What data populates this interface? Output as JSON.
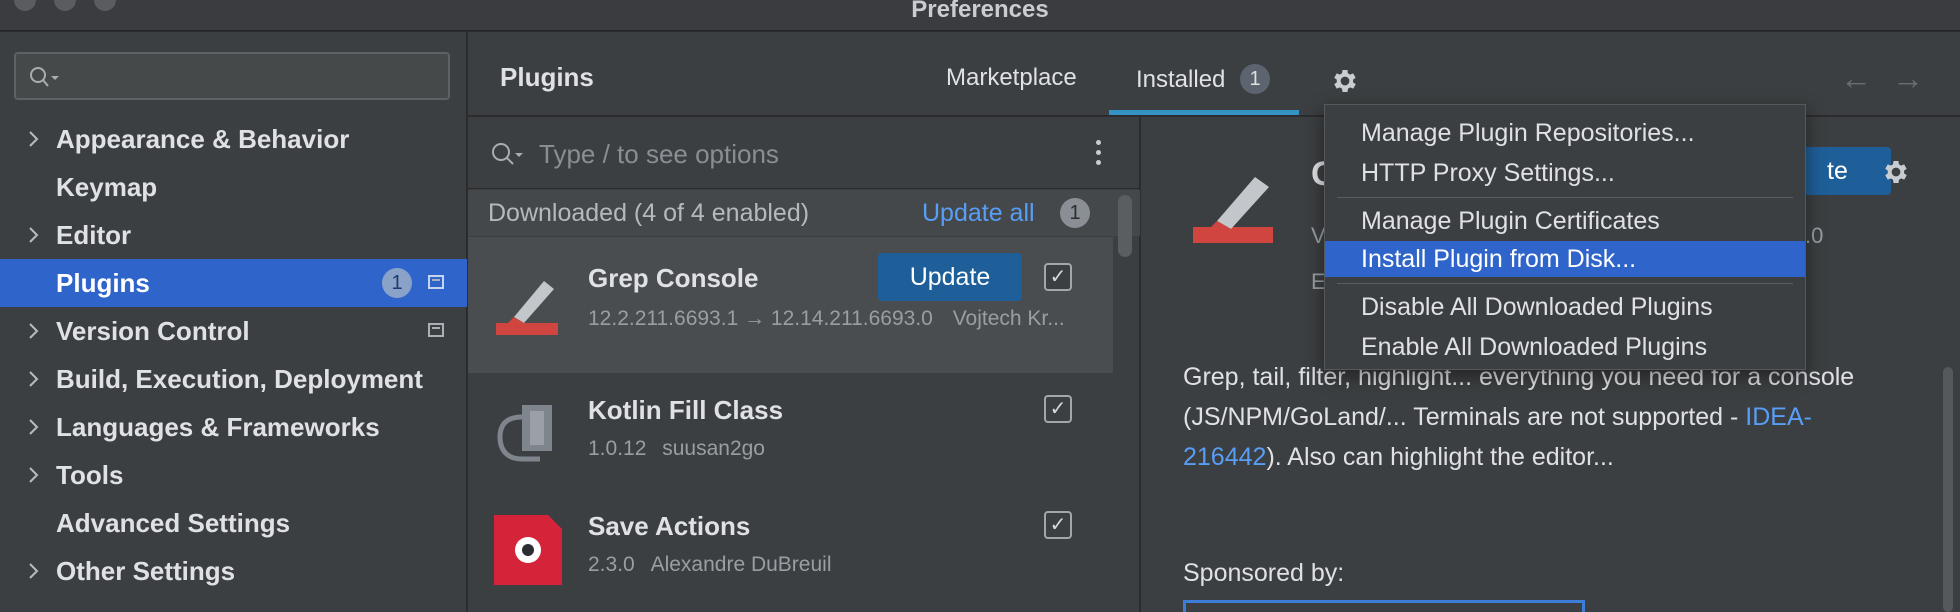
{
  "window": {
    "title": "Preferences"
  },
  "sidebar": {
    "search_placeholder": "",
    "items": [
      {
        "label": "Appearance & Behavior",
        "expandable": true
      },
      {
        "label": "Keymap",
        "expandable": false
      },
      {
        "label": "Editor",
        "expandable": true
      },
      {
        "label": "Plugins",
        "expandable": false,
        "selected": true,
        "badge": "1"
      },
      {
        "label": "Version Control",
        "expandable": true
      },
      {
        "label": "Build, Execution, Deployment",
        "expandable": true
      },
      {
        "label": "Languages & Frameworks",
        "expandable": true
      },
      {
        "label": "Tools",
        "expandable": true
      },
      {
        "label": "Advanced Settings",
        "expandable": false
      },
      {
        "label": "Other Settings",
        "expandable": true
      }
    ]
  },
  "header": {
    "title": "Plugins",
    "tabs": [
      {
        "label": "Marketplace"
      },
      {
        "label": "Installed",
        "badge": "1",
        "active": true
      }
    ],
    "settings_icon": "gear-icon",
    "back_icon": "arrow-left-icon",
    "forward_icon": "arrow-right-icon"
  },
  "plugin_list": {
    "search_placeholder": "Type / to see options",
    "group": {
      "label": "Downloaded (4 of 4 enabled)",
      "update_all": "Update all",
      "badge": "1"
    },
    "plugins": [
      {
        "name": "Grep Console",
        "version": "12.2.211.6693.1 → 12.14.211.6693.0",
        "author": "Vojtech Kr...",
        "update_label": "Update",
        "enabled": true
      },
      {
        "name": "Kotlin Fill Class",
        "version": "1.0.12",
        "author": "suusan2go",
        "enabled": true
      },
      {
        "name": "Save Actions",
        "version": "2.3.0",
        "author": "Alexandre DuBreuil",
        "enabled": true
      }
    ]
  },
  "detail": {
    "description_before_link": "Grep, tail, filter, highlight... everything you need for a console (JS/NPM/GoLand/... Terminals are not supported - ",
    "link_text": "IDEA-216442",
    "description_after_link": "). Also can highlight the editor...",
    "sponsored_label": "Sponsored by:",
    "action_button_fragment": "te",
    "fragments": {
      "v": "V",
      "e": "E",
      "version_tail": ".0"
    }
  },
  "settings_menu": {
    "items": [
      {
        "label": "Manage Plugin Repositories..."
      },
      {
        "label": "HTTP Proxy Settings..."
      },
      {
        "label": "Manage Plugin Certificates"
      },
      {
        "label": "Install Plugin from Disk...",
        "highlighted": true
      },
      {
        "label": "Disable All Downloaded Plugins"
      },
      {
        "label": "Enable All Downloaded Plugins"
      }
    ]
  },
  "colors": {
    "accent": "#2f65ca",
    "link": "#589df6",
    "button": "#1f5f99",
    "tab_underline": "#3592c4"
  }
}
